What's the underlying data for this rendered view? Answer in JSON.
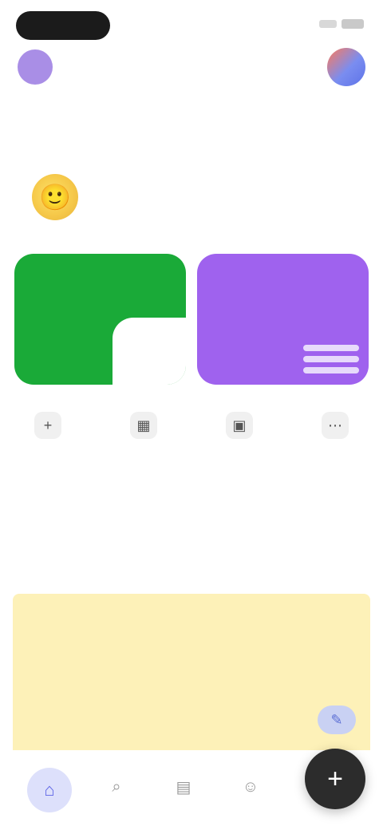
{
  "status_bar": {
    "time": "",
    "carrier": ""
  },
  "header": {
    "subtitle": ""
  },
  "greeting": {
    "emoji": "🙂",
    "title": "",
    "subtitle": ""
  },
  "cards": [
    {
      "label": "",
      "value": "",
      "color": "#1aaa38"
    },
    {
      "label": "",
      "value": "",
      "color": "#9f62ee"
    }
  ],
  "actions": [
    {
      "icon": "add-icon",
      "glyph": "+",
      "label": ""
    },
    {
      "icon": "grid-icon",
      "glyph": "▦",
      "label": ""
    },
    {
      "icon": "wallet-icon",
      "glyph": "▣",
      "label": ""
    },
    {
      "icon": "more-icon",
      "glyph": "⋯",
      "label": ""
    }
  ],
  "section": {
    "title": "",
    "more": ""
  },
  "note": {
    "title": "",
    "button_glyph": "✎"
  },
  "tabbar": {
    "tabs": [
      {
        "icon": "home-icon",
        "glyph": "⌂",
        "label": ""
      },
      {
        "icon": "search-icon",
        "glyph": "⌕",
        "label": ""
      },
      {
        "icon": "chart-icon",
        "glyph": "▤",
        "label": ""
      },
      {
        "icon": "user-icon",
        "glyph": "☺",
        "label": ""
      }
    ],
    "fab_glyph": "+"
  },
  "colors": {
    "accent": "#5d64e6",
    "green": "#1aaa38",
    "purple": "#9f62ee",
    "note": "#fdf1b8",
    "fab": "#2c2c2c"
  }
}
